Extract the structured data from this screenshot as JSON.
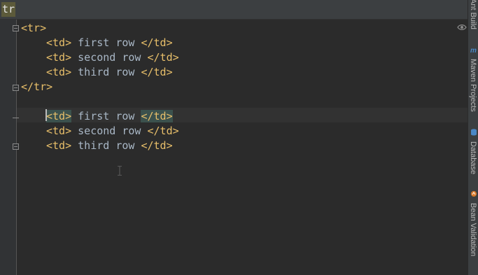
{
  "search": {
    "text": "tr"
  },
  "editor": {
    "lines": [
      {
        "parts": [
          "<tr>"
        ]
      },
      {
        "parts": [
          "<td>",
          " first row ",
          "</td>"
        ]
      },
      {
        "parts": [
          "<td>",
          " second row ",
          "</td>"
        ]
      },
      {
        "parts": [
          "<td>",
          " third row ",
          "</td>"
        ]
      },
      {
        "parts": [
          "</tr>"
        ]
      },
      {
        "parts": [
          "<td>",
          " first row ",
          "</td>"
        ]
      },
      {
        "parts": [
          "<td>",
          " second row ",
          "</td>"
        ]
      },
      {
        "parts": [
          "<td>",
          " third row ",
          "</td>"
        ]
      }
    ]
  },
  "tool_windows": [
    {
      "label": "Ant Build",
      "icon": "ant-icon"
    },
    {
      "label": "Maven Projects",
      "icon": "maven-icon"
    },
    {
      "label": "Database",
      "icon": "database-icon"
    },
    {
      "label": "Bean Validation",
      "icon": "bean-icon"
    }
  ],
  "colors": {
    "tag": "#e8bf6a",
    "text": "#a9b7c6",
    "background": "#2b2b2b",
    "gutter": "#313335"
  }
}
